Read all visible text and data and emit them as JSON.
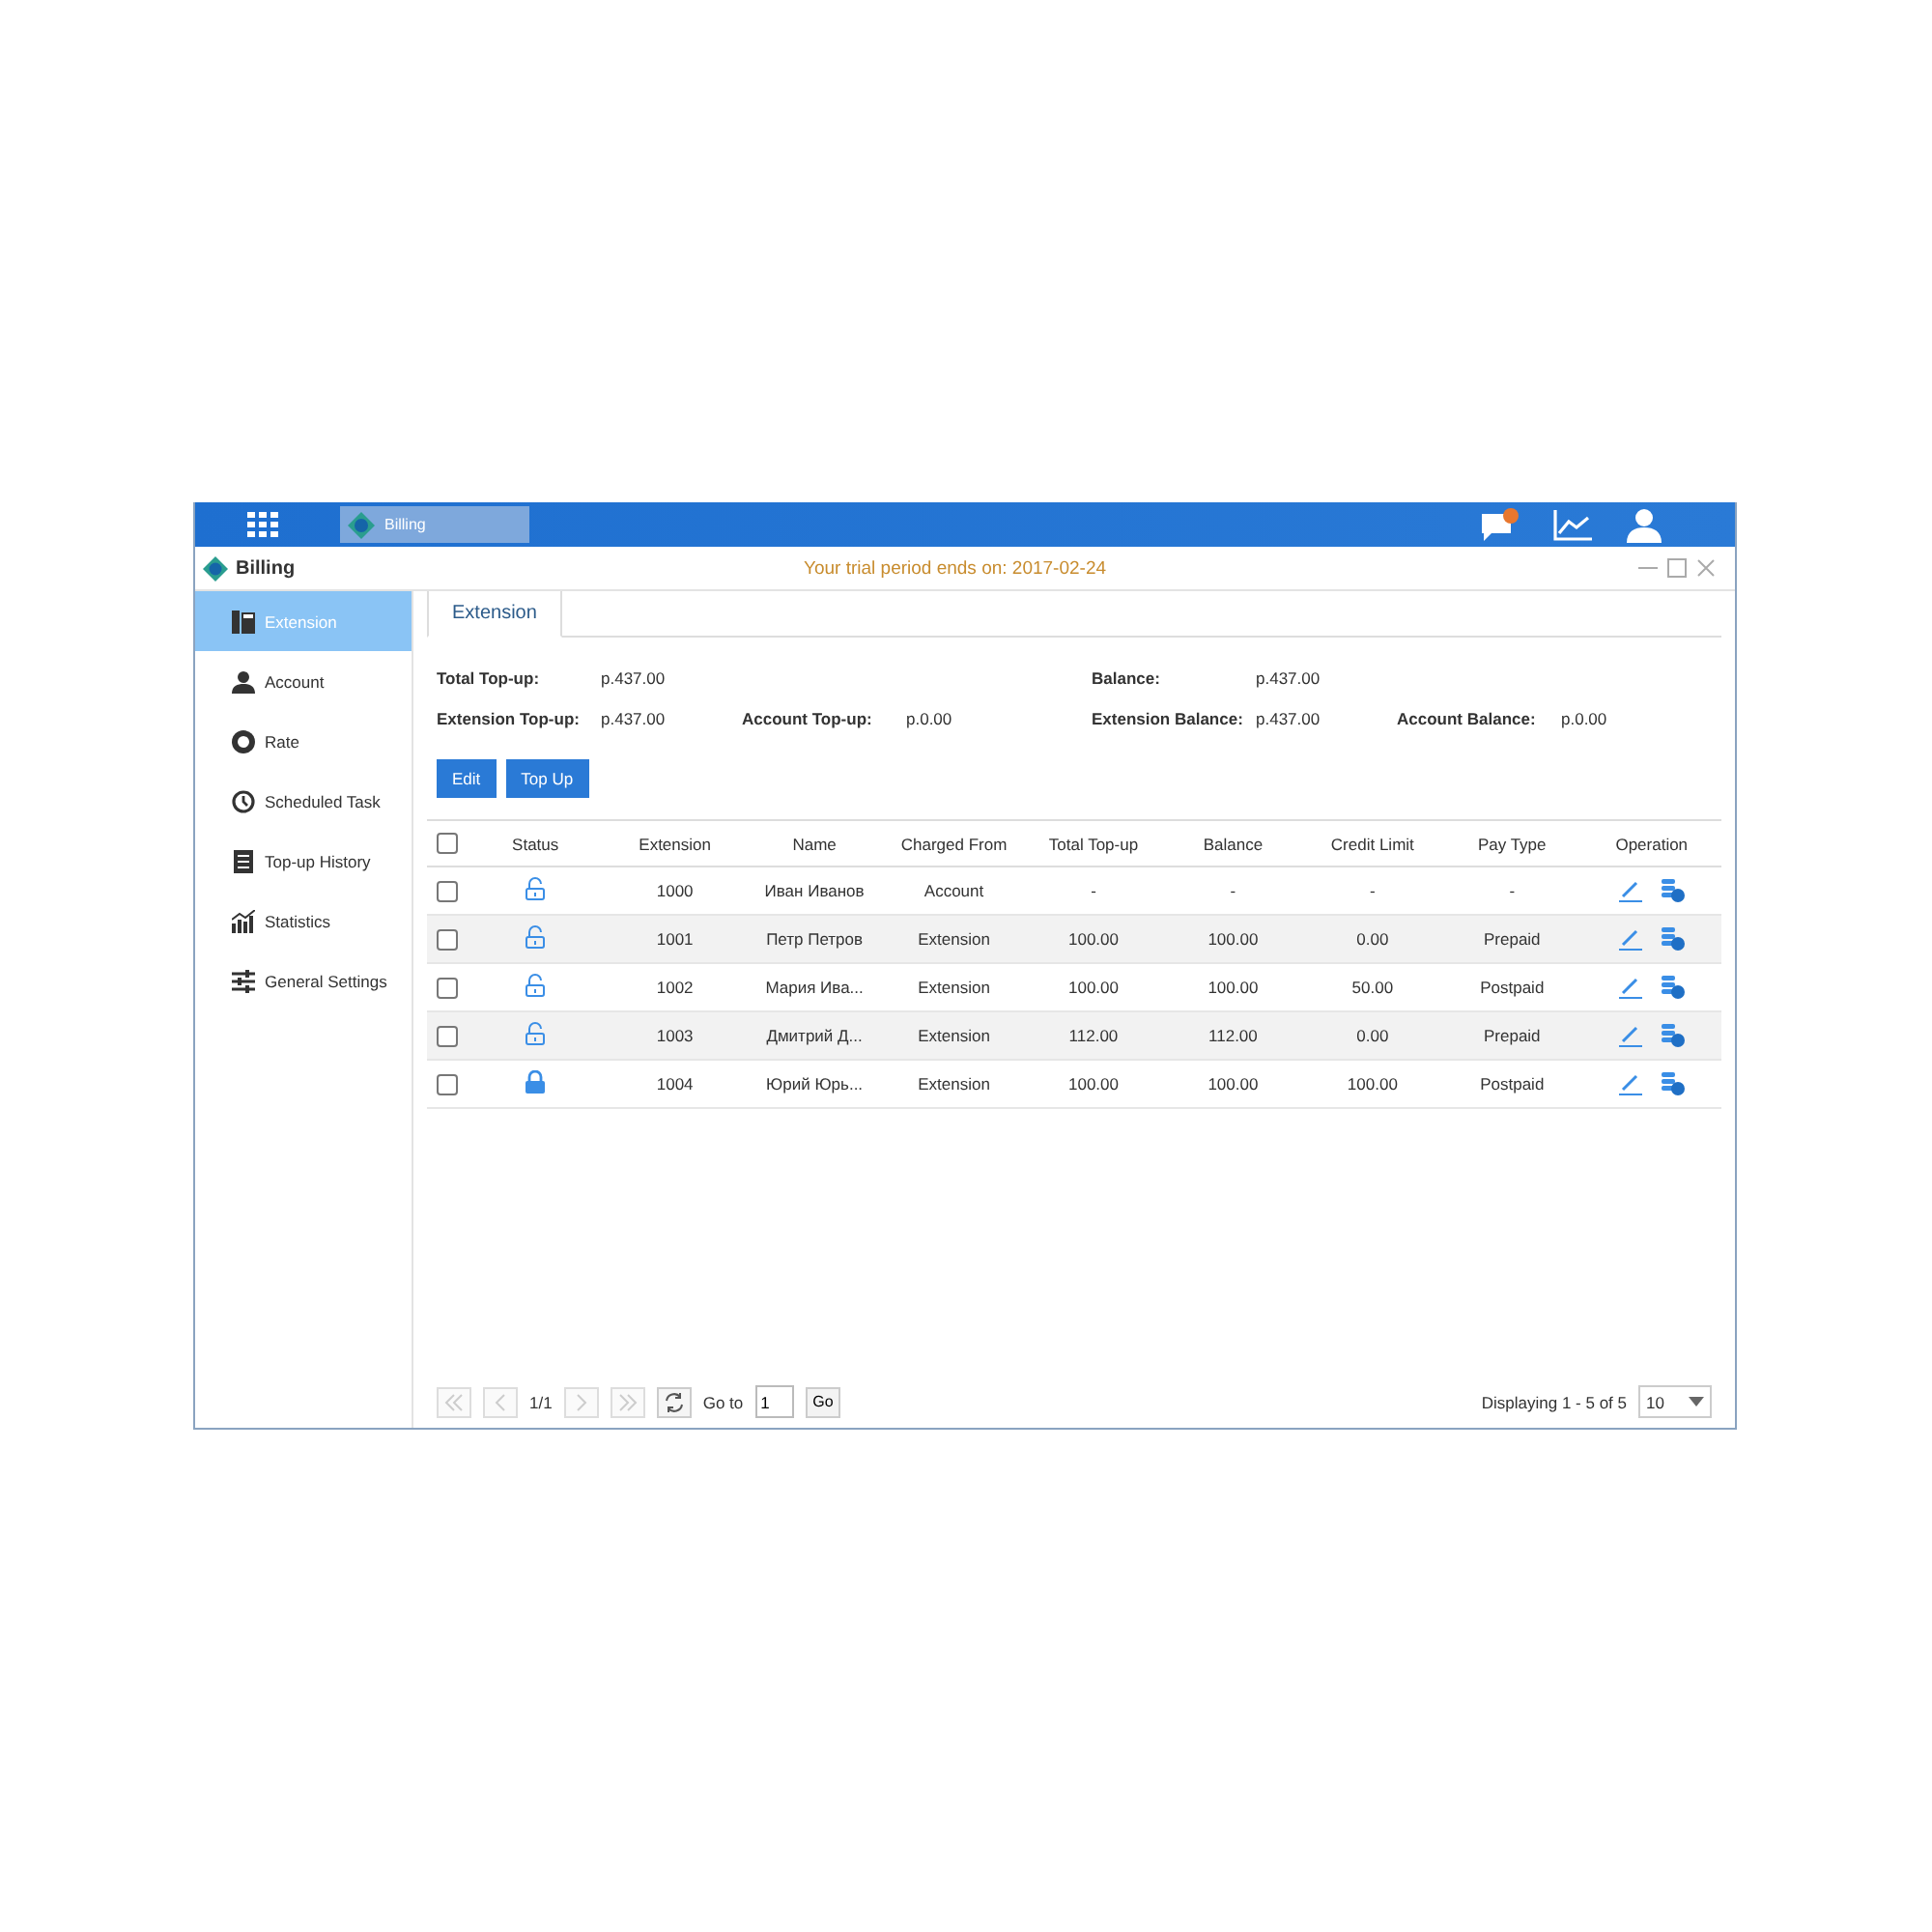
{
  "taskbar": {
    "app": {
      "title": "Billing",
      "selected": true
    },
    "notification": true
  },
  "window": {
    "title": "Billing",
    "notice": "Your trial period ends on: 2017-02-24"
  },
  "sidebar": {
    "items": [
      {
        "label": "Extension",
        "kind": "phone",
        "selected": true
      },
      {
        "label": "Account",
        "kind": "person",
        "selected": false
      },
      {
        "label": "Rate",
        "kind": "coin",
        "selected": false
      },
      {
        "label": "Scheduled Task",
        "kind": "clock",
        "selected": false
      },
      {
        "label": "Top-up History",
        "kind": "list",
        "selected": false
      },
      {
        "label": "Statistics",
        "kind": "stats",
        "selected": false
      },
      {
        "label": "General Settings",
        "kind": "sliders",
        "selected": false
      }
    ]
  },
  "tabs": [
    {
      "label": "Extension",
      "selected": true
    }
  ],
  "summary": {
    "left": [
      {
        "label": "Total Top-up:",
        "value": "р.437.00"
      },
      {
        "label": "Extension Top-up:",
        "value": "р.437.00"
      }
    ],
    "middle": [
      {
        "label": "Account Top-up:",
        "value": "р.0.00"
      }
    ],
    "right": [
      {
        "label": "Balance:",
        "value": "р.437.00"
      },
      {
        "label": "Extension Balance:",
        "value": "р.437.00"
      }
    ],
    "far": [
      {
        "label": "Account Balance:",
        "value": "р.0.00"
      }
    ]
  },
  "buttons": [
    "Edit",
    "Top Up"
  ],
  "table": {
    "select_all_checked": false,
    "columns": [
      "Status",
      "Extension",
      "Name",
      "Charged From",
      "Total Top-up",
      "Balance",
      "Credit Limit",
      "Pay Type",
      "Operation"
    ],
    "rows": [
      {
        "checked": false,
        "locked": false,
        "extension": "1000",
        "name": "Иван Иванов",
        "charged_from": "Account",
        "total_top_up": "-",
        "balance": "-",
        "credit_limit": "-",
        "pay_type": "-"
      },
      {
        "checked": false,
        "locked": false,
        "extension": "1001",
        "name": "Петр Петров",
        "charged_from": "Extension",
        "total_top_up": "100.00",
        "balance": "100.00",
        "credit_limit": "0.00",
        "pay_type": "Prepaid"
      },
      {
        "checked": false,
        "locked": false,
        "extension": "1002",
        "name": "Мария Ива...",
        "charged_from": "Extension",
        "total_top_up": "100.00",
        "balance": "100.00",
        "credit_limit": "50.00",
        "pay_type": "Postpaid"
      },
      {
        "checked": false,
        "locked": false,
        "extension": "1003",
        "name": "Дмитрий Д...",
        "charged_from": "Extension",
        "total_top_up": "112.00",
        "balance": "112.00",
        "credit_limit": "0.00",
        "pay_type": "Prepaid"
      },
      {
        "checked": false,
        "locked": true,
        "extension": "1004",
        "name": "Юрий Юрь...",
        "charged_from": "Extension",
        "total_top_up": "100.00",
        "balance": "100.00",
        "credit_limit": "100.00",
        "pay_type": "Postpaid"
      }
    ]
  },
  "pagination": {
    "page": "1/1",
    "goto_label": "Go to",
    "goto_value": "1",
    "go": "Go",
    "display": "Displaying 1 - 5 of 5",
    "page_size": "10"
  }
}
